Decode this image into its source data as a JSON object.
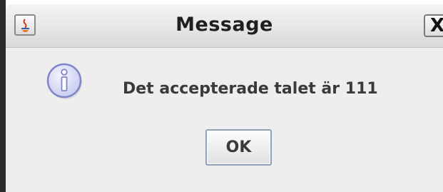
{
  "window": {
    "title": "Message",
    "app_icon": "java-coffee-cup-icon",
    "close_icon": "close-icon",
    "close_glyph": "X"
  },
  "dialog": {
    "icon": "information-icon",
    "message": "Det accepterade talet är 111",
    "ok_label": "OK"
  },
  "colors": {
    "info_icon_fill": "#d7d9f5",
    "info_icon_border": "#7f86c9",
    "ok_border": "#8fa0b8",
    "content_background": "#eeeeee"
  }
}
